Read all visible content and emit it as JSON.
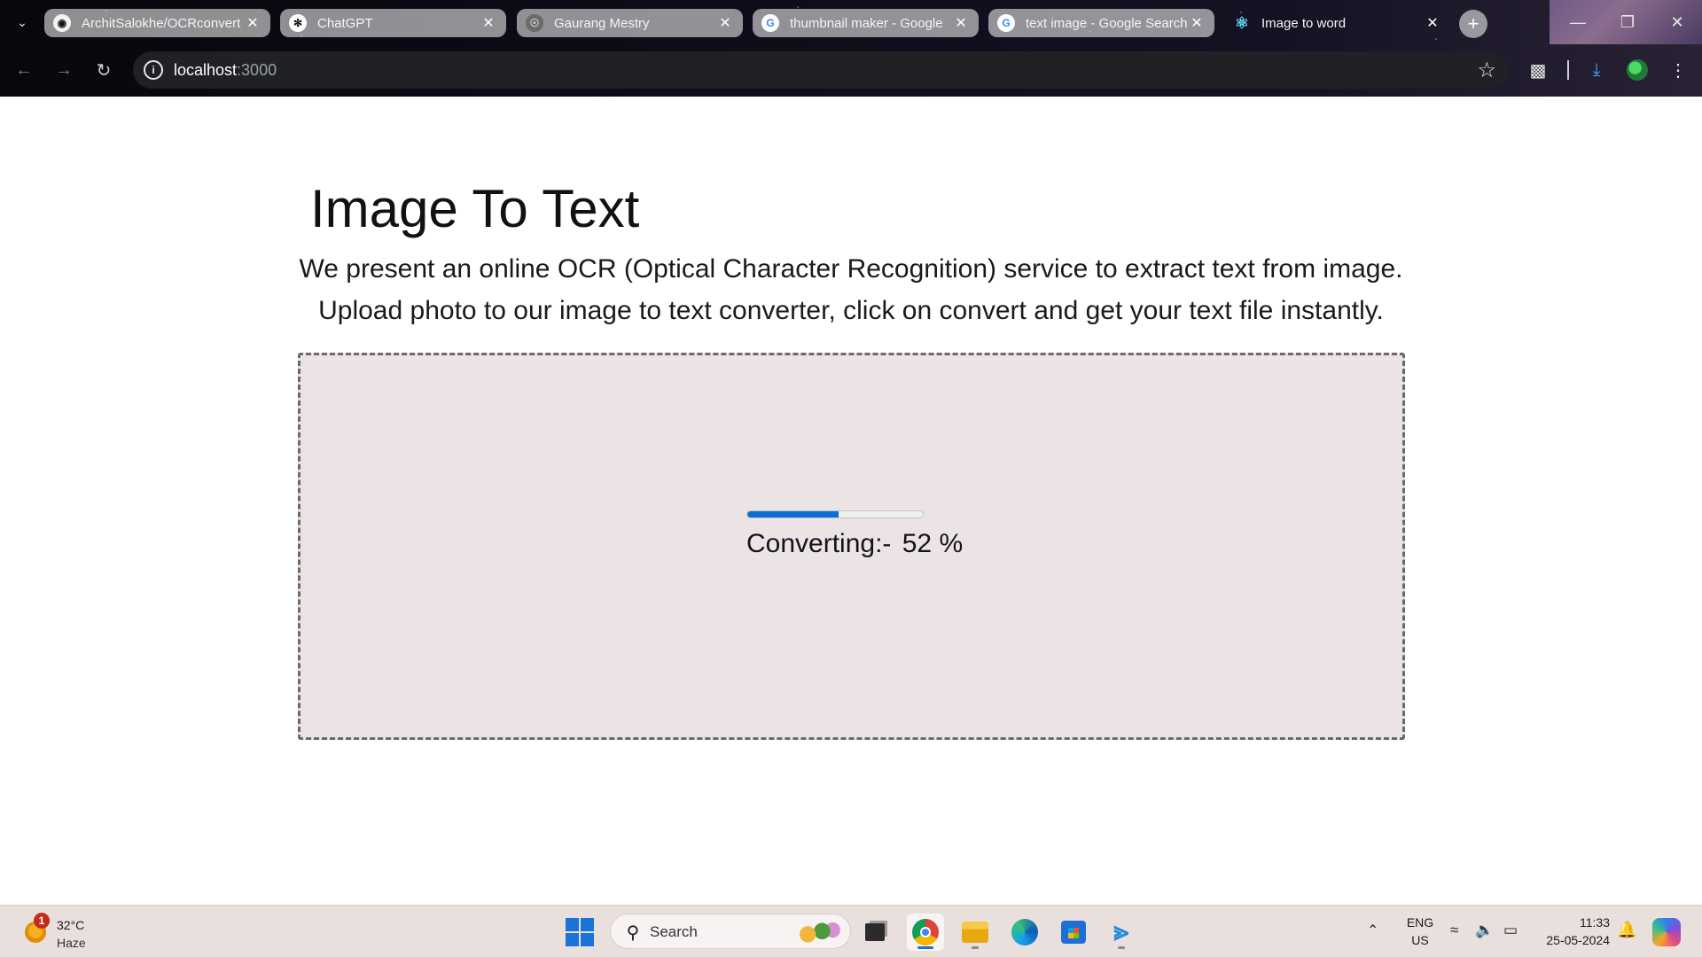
{
  "browser": {
    "tabs": [
      {
        "title": "ArchitSalokhe/OCRconvert",
        "favicon": "github-icon",
        "active": false
      },
      {
        "title": "ChatGPT",
        "favicon": "chatgpt-icon",
        "active": false
      },
      {
        "title": "Gaurang Mestry",
        "favicon": "globe-icon",
        "active": false
      },
      {
        "title": "thumbnail maker - Google",
        "favicon": "google-icon",
        "active": false
      },
      {
        "title": "text image - Google Search",
        "favicon": "google-icon",
        "active": false
      },
      {
        "title": "Image to word",
        "favicon": "react-icon",
        "active": true
      }
    ],
    "url_host": "localhost",
    "url_port": ":3000"
  },
  "page": {
    "title": "Image To Text",
    "description_line1": "We present an online OCR (Optical Character Recognition) service to extract text from image.",
    "description_line2": "Upload photo to our image to text converter, click on convert and get your text file instantly.",
    "progress": {
      "label": "Converting:-",
      "percent_text": "52 %",
      "percent": 52,
      "fill_color": "#0b6ed8"
    }
  },
  "taskbar": {
    "weather": {
      "temp": "32°C",
      "condition": "Haze",
      "badge": "1"
    },
    "search_placeholder": "Search",
    "language": {
      "line1": "ENG",
      "line2": "US"
    },
    "clock": {
      "time": "11:33",
      "date": "25-05-2024"
    }
  },
  "colors": {
    "accent": "#0b6ed8",
    "dropzone_bg": "#ece4e4",
    "taskbar_bg": "#e9dfdd"
  }
}
